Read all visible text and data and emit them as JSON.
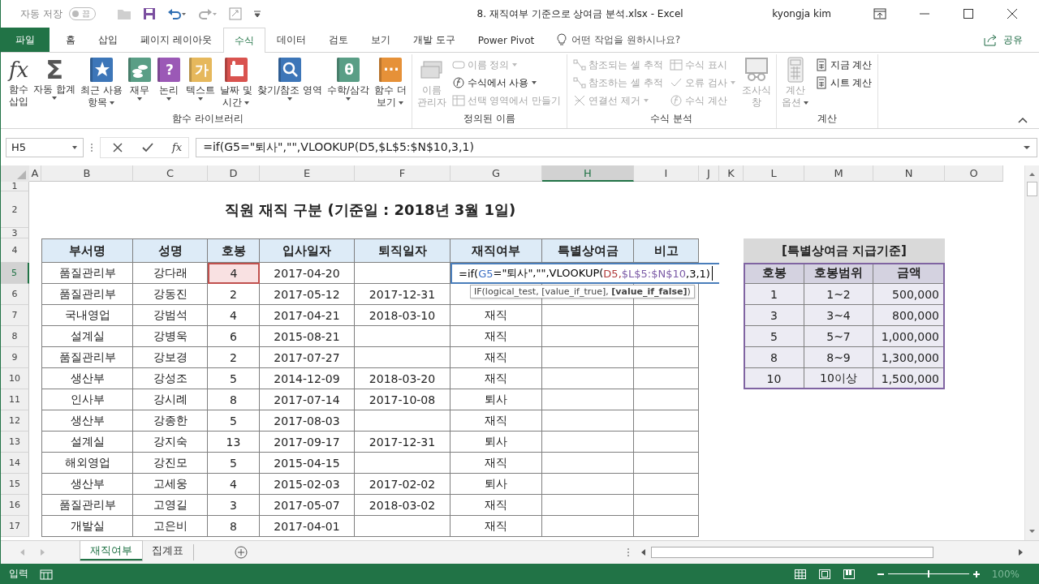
{
  "quick_access": {
    "autosave_label": "자동 저장",
    "autosave_state": "끔",
    "autosave_on": false
  },
  "window": {
    "title": "8. 재직여부 기준으로 상여금 분석.xlsx  -  Excel",
    "user": "kyongja kim"
  },
  "tabs": [
    {
      "label": "파일",
      "kind": "file",
      "selected": false
    },
    {
      "label": "홈",
      "kind": "tab",
      "selected": false
    },
    {
      "label": "삽입",
      "kind": "tab",
      "selected": false
    },
    {
      "label": "페이지 레이아웃",
      "kind": "tab",
      "selected": false
    },
    {
      "label": "수식",
      "kind": "tab",
      "selected": true
    },
    {
      "label": "데이터",
      "kind": "tab",
      "selected": false
    },
    {
      "label": "검토",
      "kind": "tab",
      "selected": false
    },
    {
      "label": "보기",
      "kind": "tab",
      "selected": false
    },
    {
      "label": "개발 도구",
      "kind": "tab",
      "selected": false
    },
    {
      "label": "Power Pivot",
      "kind": "tab",
      "selected": false
    }
  ],
  "tell_me": "어떤 작업을 원하시나요?",
  "share": "공유",
  "ribbon": {
    "groups": [
      {
        "label": "함수 라이브러리",
        "items": [
          {
            "kind": "big",
            "lines": [
              "함수",
              "삽입"
            ],
            "dropdown": false,
            "disabled": false,
            "glyph": "fx"
          },
          {
            "kind": "big",
            "lines": [
              "자동 합계"
            ],
            "dropdown": true,
            "disabled": false,
            "glyph": "Σ"
          },
          {
            "kind": "big",
            "lines": [
              "최근 사용",
              "항목"
            ],
            "dropdown": true,
            "disabled": false
          },
          {
            "kind": "big",
            "lines": [
              "재무"
            ],
            "dropdown": true,
            "disabled": false
          },
          {
            "kind": "big",
            "lines": [
              "논리"
            ],
            "dropdown": true,
            "disabled": false,
            "glyph": "?"
          },
          {
            "kind": "big",
            "lines": [
              "텍스트"
            ],
            "dropdown": true,
            "disabled": false,
            "glyph": "가"
          },
          {
            "kind": "big",
            "lines": [
              "날짜 및",
              "시간"
            ],
            "dropdown": true,
            "disabled": false
          },
          {
            "kind": "big",
            "lines": [
              "찾기/참조 영역"
            ],
            "dropdown": true,
            "disabled": false
          },
          {
            "kind": "big",
            "lines": [
              "수학/삼각"
            ],
            "dropdown": true,
            "disabled": false,
            "glyph": "θ"
          },
          {
            "kind": "big",
            "lines": [
              "함수 더",
              "보기"
            ],
            "dropdown": true,
            "disabled": false,
            "glyph": "···"
          }
        ]
      },
      {
        "label": "정의된 이름",
        "items": [
          {
            "kind": "big",
            "lines": [
              "이름",
              "관리자"
            ],
            "dropdown": false,
            "disabled": true
          },
          {
            "kind": "stack",
            "items": [
              {
                "label": "이름 정의",
                "dropdown": true,
                "disabled": true
              },
              {
                "label": "수식에서 사용",
                "dropdown": true,
                "disabled": false
              },
              {
                "label": "선택 영역에서 만들기",
                "dropdown": false,
                "disabled": true
              }
            ]
          }
        ]
      },
      {
        "label": "수식 분석",
        "items": [
          {
            "kind": "stack",
            "items": [
              {
                "label": "참조되는 셀 추적",
                "dropdown": false,
                "disabled": true
              },
              {
                "label": "참조하는 셀 추적",
                "dropdown": false,
                "disabled": true
              },
              {
                "label": "연결선 제거",
                "dropdown": true,
                "disabled": true
              }
            ]
          },
          {
            "kind": "stack",
            "items": [
              {
                "label": "수식 표시",
                "dropdown": false,
                "disabled": true
              },
              {
                "label": "오류 검사",
                "dropdown": true,
                "disabled": true
              },
              {
                "label": "수식 계산",
                "dropdown": false,
                "disabled": true
              }
            ]
          },
          {
            "kind": "big",
            "lines": [
              "조사식",
              "창"
            ],
            "dropdown": false,
            "disabled": true
          }
        ]
      },
      {
        "label": "계산",
        "items": [
          {
            "kind": "big",
            "lines": [
              "계산",
              "옵션"
            ],
            "dropdown": true,
            "disabled": true
          },
          {
            "kind": "stack",
            "items": [
              {
                "label": "지금 계산",
                "dropdown": false,
                "disabled": false
              },
              {
                "label": "시트 계산",
                "dropdown": false,
                "disabled": false
              }
            ]
          }
        ]
      }
    ]
  },
  "formula_bar": {
    "name_box": "H5",
    "function_glyph": "fx",
    "formula": "=if(G5=\"퇴사\",\"\",VLOOKUP(D5,$L$5:$N$10,3,1)"
  },
  "columns": [
    {
      "label": "A",
      "selected": false
    },
    {
      "label": "B",
      "selected": false
    },
    {
      "label": "C",
      "selected": false
    },
    {
      "label": "D",
      "selected": false
    },
    {
      "label": "E",
      "selected": false
    },
    {
      "label": "F",
      "selected": false
    },
    {
      "label": "G",
      "selected": false
    },
    {
      "label": "H",
      "selected": true
    },
    {
      "label": "I",
      "selected": false
    },
    {
      "label": "J",
      "selected": false
    },
    {
      "label": "K",
      "selected": false
    },
    {
      "label": "L",
      "selected": false
    },
    {
      "label": "M",
      "selected": false
    },
    {
      "label": "N",
      "selected": false
    },
    {
      "label": "O",
      "selected": false
    }
  ],
  "row_numbers": [
    {
      "label": "1",
      "selected": false
    },
    {
      "label": "2",
      "selected": false
    },
    {
      "label": "3",
      "selected": false
    },
    {
      "label": "4",
      "selected": false
    },
    {
      "label": "5",
      "selected": true
    },
    {
      "label": "6",
      "selected": false
    },
    {
      "label": "7",
      "selected": false
    },
    {
      "label": "8",
      "selected": false
    },
    {
      "label": "9",
      "selected": false
    },
    {
      "label": "10",
      "selected": false
    },
    {
      "label": "11",
      "selected": false
    },
    {
      "label": "12",
      "selected": false
    },
    {
      "label": "13",
      "selected": false
    },
    {
      "label": "14",
      "selected": false
    },
    {
      "label": "15",
      "selected": false
    },
    {
      "label": "16",
      "selected": false
    },
    {
      "label": "17",
      "selected": false
    }
  ],
  "sheet_title": "직원 재직 구분 (기준일 : 2018년 3월 1일)",
  "main_table": {
    "headers": [
      "부서명",
      "성명",
      "호봉",
      "입사일자",
      "퇴직일자",
      "재직여부",
      "특별상여금",
      "비고"
    ],
    "rows": [
      {
        "department": "품질관리부",
        "name": "강다래",
        "grade": "4",
        "hire_date": "2017-04-20",
        "grade_referenced": true
      },
      {
        "department": "품질관리부",
        "name": "강동진",
        "grade": "2",
        "hire_date": "2017-05-12",
        "leave_date": "2017-12-31"
      },
      {
        "department": "국내영업",
        "name": "강범석",
        "grade": "4",
        "hire_date": "2017-04-21",
        "leave_date": "2018-03-10",
        "status": "재직"
      },
      {
        "department": "설계실",
        "name": "강병욱",
        "grade": "6",
        "hire_date": "2015-08-21",
        "status": "재직"
      },
      {
        "department": "품질관리부",
        "name": "강보경",
        "grade": "2",
        "hire_date": "2017-07-27",
        "status": "재직"
      },
      {
        "department": "생산부",
        "name": "강성조",
        "grade": "5",
        "hire_date": "2014-12-09",
        "leave_date": "2018-03-20",
        "status": "재직"
      },
      {
        "department": "인사부",
        "name": "강시례",
        "grade": "8",
        "hire_date": "2017-07-14",
        "leave_date": "2017-10-08",
        "status": "퇴사"
      },
      {
        "department": "생산부",
        "name": "강종한",
        "grade": "5",
        "hire_date": "2017-08-03",
        "status": "재직"
      },
      {
        "department": "설계실",
        "name": "강지숙",
        "grade": "13",
        "hire_date": "2017-09-17",
        "leave_date": "2017-12-31",
        "status": "퇴사"
      },
      {
        "department": "해외영업",
        "name": "강진모",
        "grade": "5",
        "hire_date": "2015-04-15",
        "status": "재직"
      },
      {
        "department": "생산부",
        "name": "고세웅",
        "grade": "4",
        "hire_date": "2015-02-03",
        "leave_date": "2017-02-02",
        "status": "퇴사"
      },
      {
        "department": "품질관리부",
        "name": "고영길",
        "grade": "3",
        "hire_date": "2017-05-07",
        "leave_date": "2018-03-02",
        "status": "재직"
      },
      {
        "department": "개발실",
        "name": "고은비",
        "grade": "8",
        "hire_date": "2017-04-01",
        "status": "재직"
      }
    ]
  },
  "formula_edit": {
    "segments": [
      {
        "text": "=if(",
        "color": "#000000"
      },
      {
        "text": "G5",
        "color": "#3b6fc4"
      },
      {
        "text": "=\"퇴사\",\"\",VLOOKUP(",
        "color": "#000000"
      },
      {
        "text": "D5,",
        "color": "#b03a3a"
      },
      {
        "text": "$L$5:$N$10",
        "color": "#7b5aa6"
      },
      {
        "text": ",3,1)",
        "color": "#000000"
      }
    ],
    "tooltip": "IF(logical_test, [value_if_true], **[value_if_false]**)"
  },
  "ref_table": {
    "title": "[특별상여금 지급기준]",
    "referenced": true,
    "headers": [
      "호봉",
      "호봉범위",
      "금액"
    ],
    "rows": [
      {
        "grade": "1",
        "range": "1~2",
        "amount": "500,000"
      },
      {
        "grade": "3",
        "range": "3~4",
        "amount": "800,000"
      },
      {
        "grade": "5",
        "range": "5~7",
        "amount": "1,000,000"
      },
      {
        "grade": "8",
        "range": "8~9",
        "amount": "1,300,000"
      },
      {
        "grade": "10",
        "range": "10이상",
        "amount": "1,500,000"
      }
    ]
  },
  "sheet_tabs": [
    {
      "label": "재직여부",
      "selected": true
    },
    {
      "label": "집계표",
      "selected": false
    }
  ],
  "status_bar": {
    "mode": "입력",
    "zoom": "100%",
    "zoom_slider": {
      "level": 0.5
    }
  }
}
